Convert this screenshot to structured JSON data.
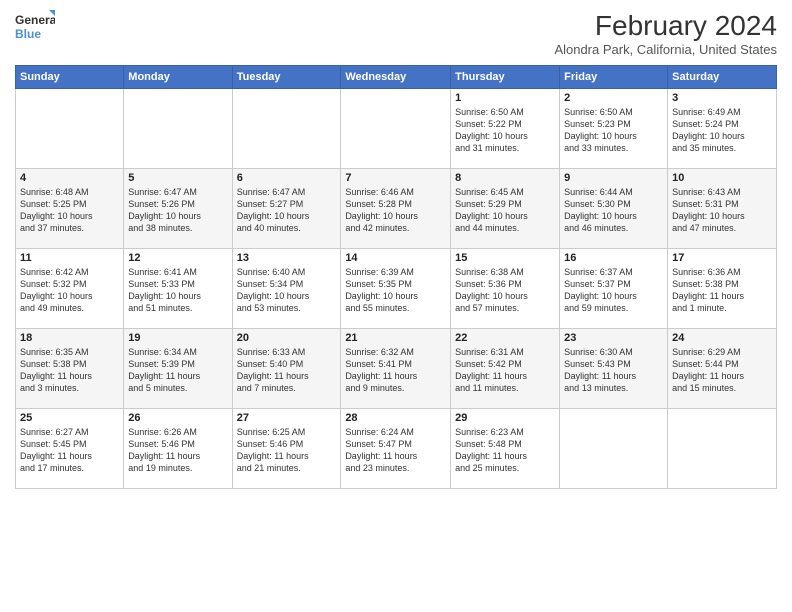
{
  "logo": {
    "line1": "General",
    "line2": "Blue"
  },
  "title": "February 2024",
  "subtitle": "Alondra Park, California, United States",
  "days_of_week": [
    "Sunday",
    "Monday",
    "Tuesday",
    "Wednesday",
    "Thursday",
    "Friday",
    "Saturday"
  ],
  "weeks": [
    [
      {
        "day": "",
        "info": ""
      },
      {
        "day": "",
        "info": ""
      },
      {
        "day": "",
        "info": ""
      },
      {
        "day": "",
        "info": ""
      },
      {
        "day": "1",
        "info": "Sunrise: 6:50 AM\nSunset: 5:22 PM\nDaylight: 10 hours\nand 31 minutes."
      },
      {
        "day": "2",
        "info": "Sunrise: 6:50 AM\nSunset: 5:23 PM\nDaylight: 10 hours\nand 33 minutes."
      },
      {
        "day": "3",
        "info": "Sunrise: 6:49 AM\nSunset: 5:24 PM\nDaylight: 10 hours\nand 35 minutes."
      }
    ],
    [
      {
        "day": "4",
        "info": "Sunrise: 6:48 AM\nSunset: 5:25 PM\nDaylight: 10 hours\nand 37 minutes."
      },
      {
        "day": "5",
        "info": "Sunrise: 6:47 AM\nSunset: 5:26 PM\nDaylight: 10 hours\nand 38 minutes."
      },
      {
        "day": "6",
        "info": "Sunrise: 6:47 AM\nSunset: 5:27 PM\nDaylight: 10 hours\nand 40 minutes."
      },
      {
        "day": "7",
        "info": "Sunrise: 6:46 AM\nSunset: 5:28 PM\nDaylight: 10 hours\nand 42 minutes."
      },
      {
        "day": "8",
        "info": "Sunrise: 6:45 AM\nSunset: 5:29 PM\nDaylight: 10 hours\nand 44 minutes."
      },
      {
        "day": "9",
        "info": "Sunrise: 6:44 AM\nSunset: 5:30 PM\nDaylight: 10 hours\nand 46 minutes."
      },
      {
        "day": "10",
        "info": "Sunrise: 6:43 AM\nSunset: 5:31 PM\nDaylight: 10 hours\nand 47 minutes."
      }
    ],
    [
      {
        "day": "11",
        "info": "Sunrise: 6:42 AM\nSunset: 5:32 PM\nDaylight: 10 hours\nand 49 minutes."
      },
      {
        "day": "12",
        "info": "Sunrise: 6:41 AM\nSunset: 5:33 PM\nDaylight: 10 hours\nand 51 minutes."
      },
      {
        "day": "13",
        "info": "Sunrise: 6:40 AM\nSunset: 5:34 PM\nDaylight: 10 hours\nand 53 minutes."
      },
      {
        "day": "14",
        "info": "Sunrise: 6:39 AM\nSunset: 5:35 PM\nDaylight: 10 hours\nand 55 minutes."
      },
      {
        "day": "15",
        "info": "Sunrise: 6:38 AM\nSunset: 5:36 PM\nDaylight: 10 hours\nand 57 minutes."
      },
      {
        "day": "16",
        "info": "Sunrise: 6:37 AM\nSunset: 5:37 PM\nDaylight: 10 hours\nand 59 minutes."
      },
      {
        "day": "17",
        "info": "Sunrise: 6:36 AM\nSunset: 5:38 PM\nDaylight: 11 hours\nand 1 minute."
      }
    ],
    [
      {
        "day": "18",
        "info": "Sunrise: 6:35 AM\nSunset: 5:38 PM\nDaylight: 11 hours\nand 3 minutes."
      },
      {
        "day": "19",
        "info": "Sunrise: 6:34 AM\nSunset: 5:39 PM\nDaylight: 11 hours\nand 5 minutes."
      },
      {
        "day": "20",
        "info": "Sunrise: 6:33 AM\nSunset: 5:40 PM\nDaylight: 11 hours\nand 7 minutes."
      },
      {
        "day": "21",
        "info": "Sunrise: 6:32 AM\nSunset: 5:41 PM\nDaylight: 11 hours\nand 9 minutes."
      },
      {
        "day": "22",
        "info": "Sunrise: 6:31 AM\nSunset: 5:42 PM\nDaylight: 11 hours\nand 11 minutes."
      },
      {
        "day": "23",
        "info": "Sunrise: 6:30 AM\nSunset: 5:43 PM\nDaylight: 11 hours\nand 13 minutes."
      },
      {
        "day": "24",
        "info": "Sunrise: 6:29 AM\nSunset: 5:44 PM\nDaylight: 11 hours\nand 15 minutes."
      }
    ],
    [
      {
        "day": "25",
        "info": "Sunrise: 6:27 AM\nSunset: 5:45 PM\nDaylight: 11 hours\nand 17 minutes."
      },
      {
        "day": "26",
        "info": "Sunrise: 6:26 AM\nSunset: 5:46 PM\nDaylight: 11 hours\nand 19 minutes."
      },
      {
        "day": "27",
        "info": "Sunrise: 6:25 AM\nSunset: 5:46 PM\nDaylight: 11 hours\nand 21 minutes."
      },
      {
        "day": "28",
        "info": "Sunrise: 6:24 AM\nSunset: 5:47 PM\nDaylight: 11 hours\nand 23 minutes."
      },
      {
        "day": "29",
        "info": "Sunrise: 6:23 AM\nSunset: 5:48 PM\nDaylight: 11 hours\nand 25 minutes."
      },
      {
        "day": "",
        "info": ""
      },
      {
        "day": "",
        "info": ""
      }
    ]
  ]
}
